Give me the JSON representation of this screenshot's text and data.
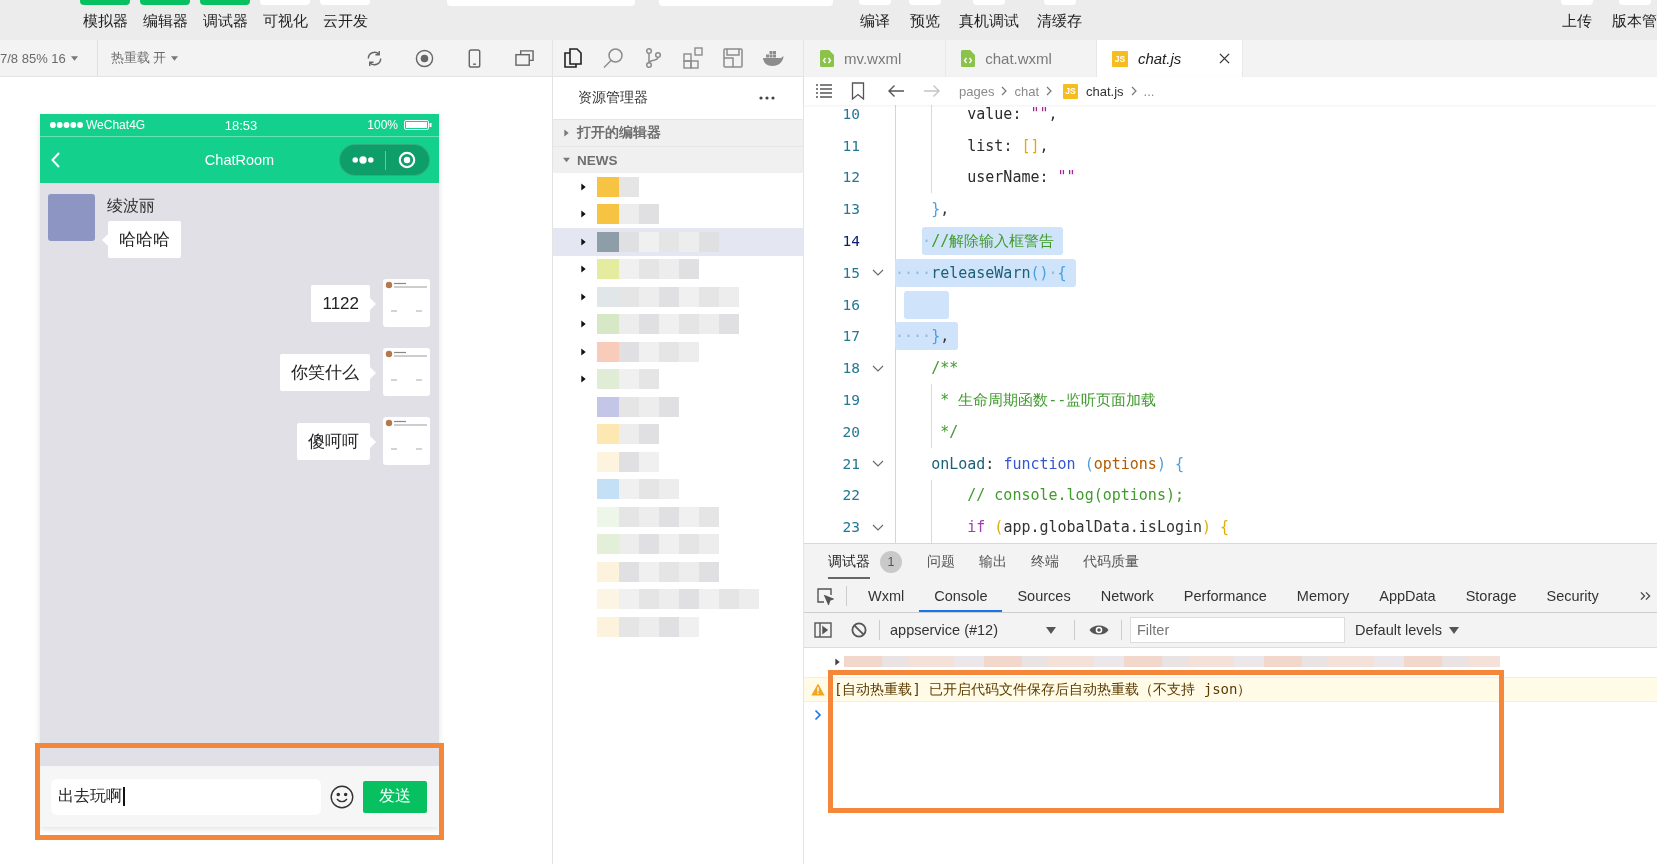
{
  "toolbar": {
    "mode_buttons": [
      {
        "label": "模拟器",
        "on": true
      },
      {
        "label": "编辑器",
        "on": true
      },
      {
        "label": "调试器",
        "on": true
      },
      {
        "label": "可视化",
        "on": false
      },
      {
        "label": "云开发",
        "on": false
      }
    ],
    "action_buttons": [
      {
        "label": "编译"
      },
      {
        "label": "预览"
      },
      {
        "label": "真机调试"
      },
      {
        "label": "清缓存"
      }
    ],
    "right_buttons": [
      {
        "label": "上传"
      },
      {
        "label": "版本管"
      }
    ]
  },
  "simulator": {
    "device": "7/8 85% 16",
    "hot_reload": "热重载 开"
  },
  "phone": {
    "status_bar": {
      "carrier": "WeChat4G",
      "time": "18:53",
      "battery": "100%"
    },
    "title": "ChatRoom",
    "messages": [
      {
        "kind": "received",
        "sender": "绫波丽",
        "text": "哈哈哈"
      },
      {
        "kind": "sent",
        "text": "1122"
      },
      {
        "kind": "sent",
        "text": "你笑什么"
      },
      {
        "kind": "sent",
        "text": "傻呵呵"
      }
    ],
    "input": {
      "value": "出去玩啊",
      "highlighted": true
    },
    "send": "发送"
  },
  "activity_bar": [
    {
      "kind": "files",
      "selected": true
    },
    {
      "kind": "search",
      "selected": false
    },
    {
      "kind": "branch",
      "selected": false
    },
    {
      "kind": "extensions",
      "selected": false
    },
    {
      "kind": "layout",
      "selected": false
    },
    {
      "kind": "whale",
      "selected": false
    }
  ],
  "explorer": {
    "title": "资源管理器",
    "sections": [
      {
        "label": "打开的编辑器",
        "expanded": false
      },
      {
        "label": "NEWS",
        "expanded": true
      }
    ],
    "tree": [
      {
        "kind": "folder",
        "expanded": false,
        "selected": false,
        "color": "#f6c343"
      },
      {
        "kind": "folder",
        "expanded": false,
        "selected": false,
        "color": "#f6c343"
      },
      {
        "kind": "folder",
        "expanded": false,
        "selected": true,
        "color": "#8e9ea8"
      },
      {
        "kind": "folder",
        "expanded": false,
        "selected": false,
        "color": "#e6ec9f"
      },
      {
        "kind": "folder",
        "expanded": false,
        "selected": false,
        "color": "#e1e6e9"
      },
      {
        "kind": "folder",
        "expanded": false,
        "selected": false,
        "color": "#d6e8c6"
      },
      {
        "kind": "folder",
        "expanded": false,
        "selected": false,
        "color": "#f9cbbb"
      },
      {
        "kind": "folder",
        "expanded": false,
        "selected": false,
        "color": "#e1ecd6"
      },
      {
        "kind": "file",
        "selected": false,
        "color": "#c3c6e6"
      },
      {
        "kind": "file",
        "selected": false,
        "color": "#fde8b4"
      },
      {
        "kind": "file",
        "selected": false,
        "color": "#fdf4df"
      },
      {
        "kind": "file",
        "selected": false,
        "color": "#c4e0f7"
      },
      {
        "kind": "file",
        "selected": false,
        "color": "#eef5e9"
      },
      {
        "kind": "file",
        "selected": false,
        "color": "#e3efd9"
      },
      {
        "kind": "file",
        "selected": false,
        "color": "#fdf2dc"
      },
      {
        "kind": "file",
        "selected": false,
        "color": "#fdf5e4"
      },
      {
        "kind": "file",
        "selected": false,
        "color": "#fdf2dc"
      }
    ]
  },
  "editor": {
    "tabs": [
      {
        "label": "mv.wxml",
        "kind": "wxml",
        "selected": false,
        "preview": false
      },
      {
        "label": "chat.wxml",
        "kind": "wxml",
        "selected": false,
        "preview": false
      },
      {
        "label": "chat.js",
        "kind": "js",
        "badge": "JS",
        "selected": true,
        "preview": true
      }
    ],
    "history": [
      {
        "kind": "back",
        "disabled": false
      },
      {
        "kind": "forward",
        "disabled": true
      }
    ],
    "breadcrumb": [
      {
        "label": "pages"
      },
      {
        "label": "chat"
      },
      {
        "label": "chat.js",
        "badge": "JS"
      },
      {
        "label": "..."
      }
    ],
    "lines": [
      {
        "number": "10",
        "selected": false,
        "current": false,
        "foldable": false,
        "tokens": [
          {
            "text": "        value",
            "kind": "key"
          },
          {
            "text": ": ",
            "kind": "punct"
          },
          {
            "text": "\"\"",
            "kind": "string"
          },
          {
            "text": ",",
            "kind": "punct"
          }
        ]
      },
      {
        "number": "11",
        "selected": false,
        "current": false,
        "foldable": false,
        "tokens": [
          {
            "text": "        list",
            "kind": "key"
          },
          {
            "text": ": ",
            "kind": "punct"
          },
          {
            "text": "[]",
            "kind": "bracket1"
          },
          {
            "text": ",",
            "kind": "punct"
          }
        ]
      },
      {
        "number": "12",
        "selected": false,
        "current": false,
        "foldable": false,
        "tokens": [
          {
            "text": "        userName",
            "kind": "key"
          },
          {
            "text": ": ",
            "kind": "punct"
          },
          {
            "text": "\"\"",
            "kind": "string"
          }
        ]
      },
      {
        "number": "13",
        "selected": false,
        "current": false,
        "foldable": false,
        "tokens": [
          {
            "text": "    }",
            "kind": "bracket2"
          },
          {
            "text": ",",
            "kind": "punct"
          }
        ]
      },
      {
        "number": "14",
        "selected": true,
        "current": true,
        "foldable": false,
        "tokens": [
          {
            "text": "   ·",
            "kind": "whitespace"
          },
          {
            "text": "//解除输入框警告",
            "kind": "comment"
          }
        ]
      },
      {
        "number": "15",
        "selected": true,
        "current": false,
        "foldable": true,
        "tokens": [
          {
            "text": "····",
            "kind": "whitespace"
          },
          {
            "text": "releaseWarn",
            "kind": "method"
          },
          {
            "text": "()",
            "kind": "bracket2"
          },
          {
            "text": "·",
            "kind": "whitespace"
          },
          {
            "text": "{",
            "kind": "bracket2"
          }
        ]
      },
      {
        "number": "16",
        "selected": true,
        "current": false,
        "foldable": false
      },
      {
        "number": "17",
        "selected": true,
        "current": false,
        "foldable": false,
        "tokens": [
          {
            "text": "····",
            "kind": "whitespace"
          },
          {
            "text": "}",
            "kind": "bracket2"
          },
          {
            "text": ",",
            "kind": "punct"
          }
        ]
      },
      {
        "number": "18",
        "selected": false,
        "current": false,
        "foldable": true,
        "tokens": [
          {
            "text": "    /**",
            "kind": "comment"
          }
        ]
      },
      {
        "number": "19",
        "selected": false,
        "current": false,
        "foldable": false,
        "tokens": [
          {
            "text": "     * 生命周期函数--监听页面加载",
            "kind": "comment"
          }
        ]
      },
      {
        "number": "20",
        "selected": false,
        "current": false,
        "foldable": false,
        "tokens": [
          {
            "text": "     */",
            "kind": "comment"
          }
        ]
      },
      {
        "number": "21",
        "selected": false,
        "current": false,
        "foldable": true,
        "tokens": [
          {
            "text": "    onLoad",
            "kind": "method"
          },
          {
            "text": ": ",
            "kind": "punct"
          },
          {
            "text": "function",
            "kind": "keyword"
          },
          {
            "text": " (",
            "kind": "bracket2"
          },
          {
            "text": "options",
            "kind": "param"
          },
          {
            "text": ")",
            "kind": "bracket2"
          },
          {
            "text": " {",
            "kind": "bracket2"
          }
        ]
      },
      {
        "number": "22",
        "selected": false,
        "current": false,
        "foldable": false,
        "tokens": [
          {
            "text": "        // console.log(options);",
            "kind": "comment"
          }
        ]
      },
      {
        "number": "23",
        "selected": false,
        "current": false,
        "foldable": true,
        "tokens": [
          {
            "text": "        if",
            "kind": "control"
          },
          {
            "text": " (",
            "kind": "bracket1"
          },
          {
            "text": "app.globalData.isLogin",
            "kind": "plain"
          },
          {
            "text": ")",
            "kind": "bracket1"
          },
          {
            "text": " {",
            "kind": "bracket1"
          }
        ]
      }
    ]
  },
  "debugger": {
    "panel_tabs": [
      {
        "label": "调试器",
        "badge": "1",
        "selected": true
      },
      {
        "label": "问题",
        "selected": false
      },
      {
        "label": "输出",
        "selected": false
      },
      {
        "label": "终端",
        "selected": false
      },
      {
        "label": "代码质量",
        "selected": false
      }
    ],
    "devtools_tabs": [
      {
        "label": "Wxml",
        "selected": false
      },
      {
        "label": "Console",
        "selected": true
      },
      {
        "label": "Sources",
        "selected": false
      },
      {
        "label": "Network",
        "selected": false
      },
      {
        "label": "Performance",
        "selected": false
      },
      {
        "label": "Memory",
        "selected": false
      },
      {
        "label": "AppData",
        "selected": false
      },
      {
        "label": "Storage",
        "selected": false
      },
      {
        "label": "Security",
        "selected": false
      }
    ],
    "context": "appservice (#12)",
    "filter": {
      "placeholder": "Filter"
    },
    "levels": "Default levels",
    "console": {
      "highlighted": true,
      "entries": [
        {
          "kind": "redacted",
          "expanded": false
        },
        {
          "kind": "warning",
          "text": "[自动热重载] 已开启代码文件保存后自动热重载（不支持 json）"
        }
      ]
    }
  }
}
